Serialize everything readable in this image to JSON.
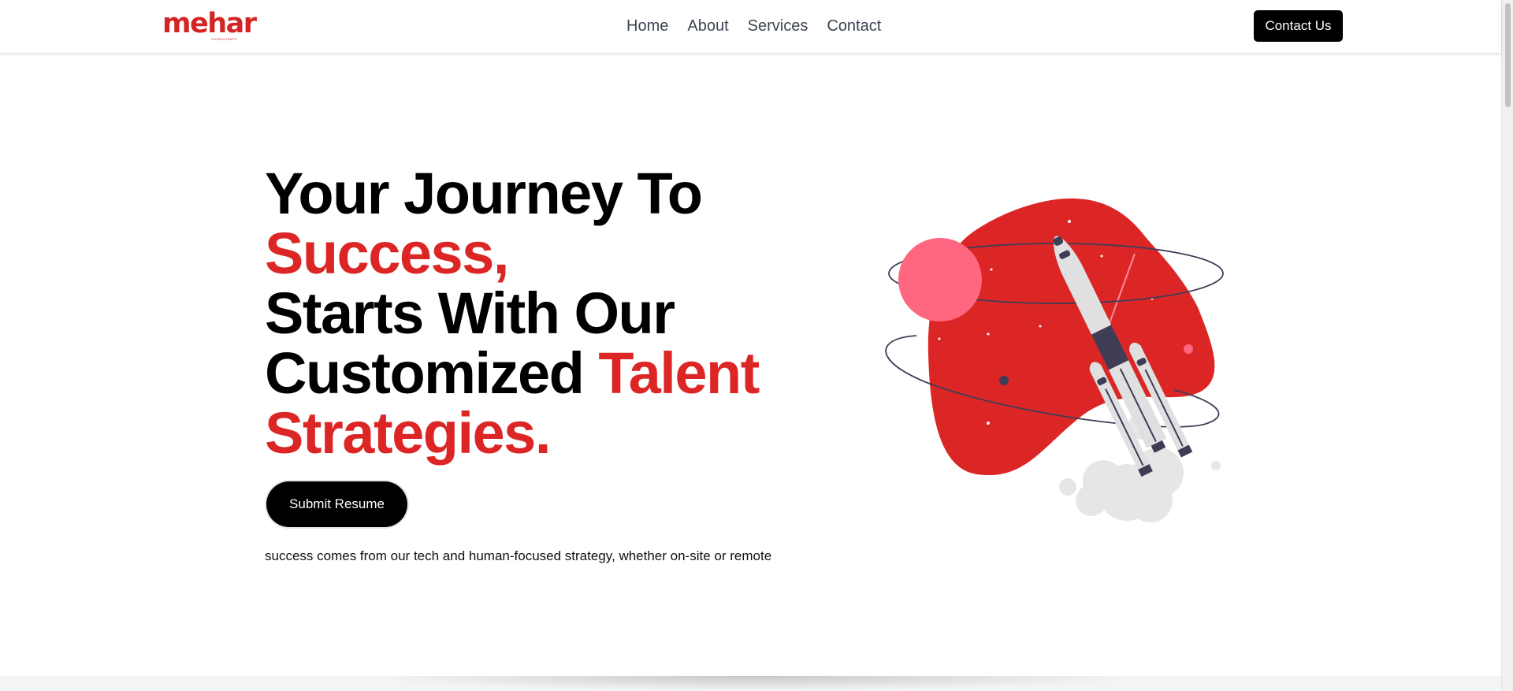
{
  "brand": {
    "logo_text": "mehar",
    "logo_subtext": "CONSULTANTS",
    "color": "#dc2626"
  },
  "nav": {
    "items": [
      {
        "label": "Home"
      },
      {
        "label": "About"
      },
      {
        "label": "Services"
      },
      {
        "label": "Contact"
      }
    ],
    "cta_label": "Contact Us"
  },
  "hero": {
    "title_line1": "Your Journey To",
    "title_line2_red": "Success,",
    "title_line3": "Starts With Our",
    "title_line4_black": "Customized ",
    "title_line4_red": "Talent",
    "title_line5_red": "Strategies.",
    "button_label": "Submit Resume",
    "subtitle": "success comes from our tech and human-focused strategy, whether on-site or remote"
  },
  "illustration": {
    "icon": "rocket-launch-illustration",
    "colors": {
      "blob": "#dc2626",
      "planet": "#ff6680",
      "rocket": "#e5e5e5",
      "rocket_dark": "#3f3d56",
      "smoke": "#e6e6e6"
    }
  }
}
